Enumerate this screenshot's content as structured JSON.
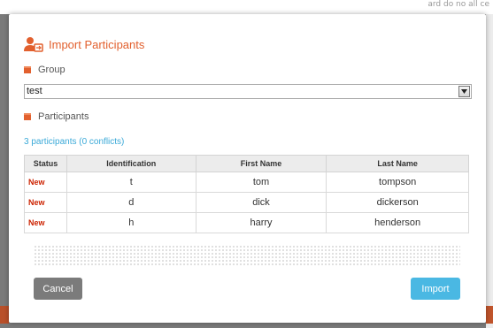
{
  "background": {
    "top_right_text": "ard do no all ce"
  },
  "dialog": {
    "title": "Import Participants",
    "title_color": "#e2602e",
    "group_label": "Group",
    "group_select": {
      "value": "test"
    },
    "participants_label": "Participants",
    "participants_summary": "3 participants (0 conflicts)",
    "table": {
      "headers": {
        "status": "Status",
        "identification": "Identification",
        "first_name": "First Name",
        "last_name": "Last Name"
      },
      "rows": [
        {
          "status": "New",
          "identification": "t",
          "first_name": "tom",
          "last_name": "tompson"
        },
        {
          "status": "New",
          "identification": "d",
          "first_name": "dick",
          "last_name": "dickerson"
        },
        {
          "status": "New",
          "identification": "h",
          "first_name": "harry",
          "last_name": "henderson"
        }
      ]
    },
    "buttons": {
      "cancel": "Cancel",
      "import": "Import"
    },
    "colors": {
      "accent": "#e2602e",
      "link": "#3aa9d8",
      "status_new": "#cc2200",
      "import_button": "#4ab8e3",
      "cancel_button": "#7b7b7b"
    }
  }
}
